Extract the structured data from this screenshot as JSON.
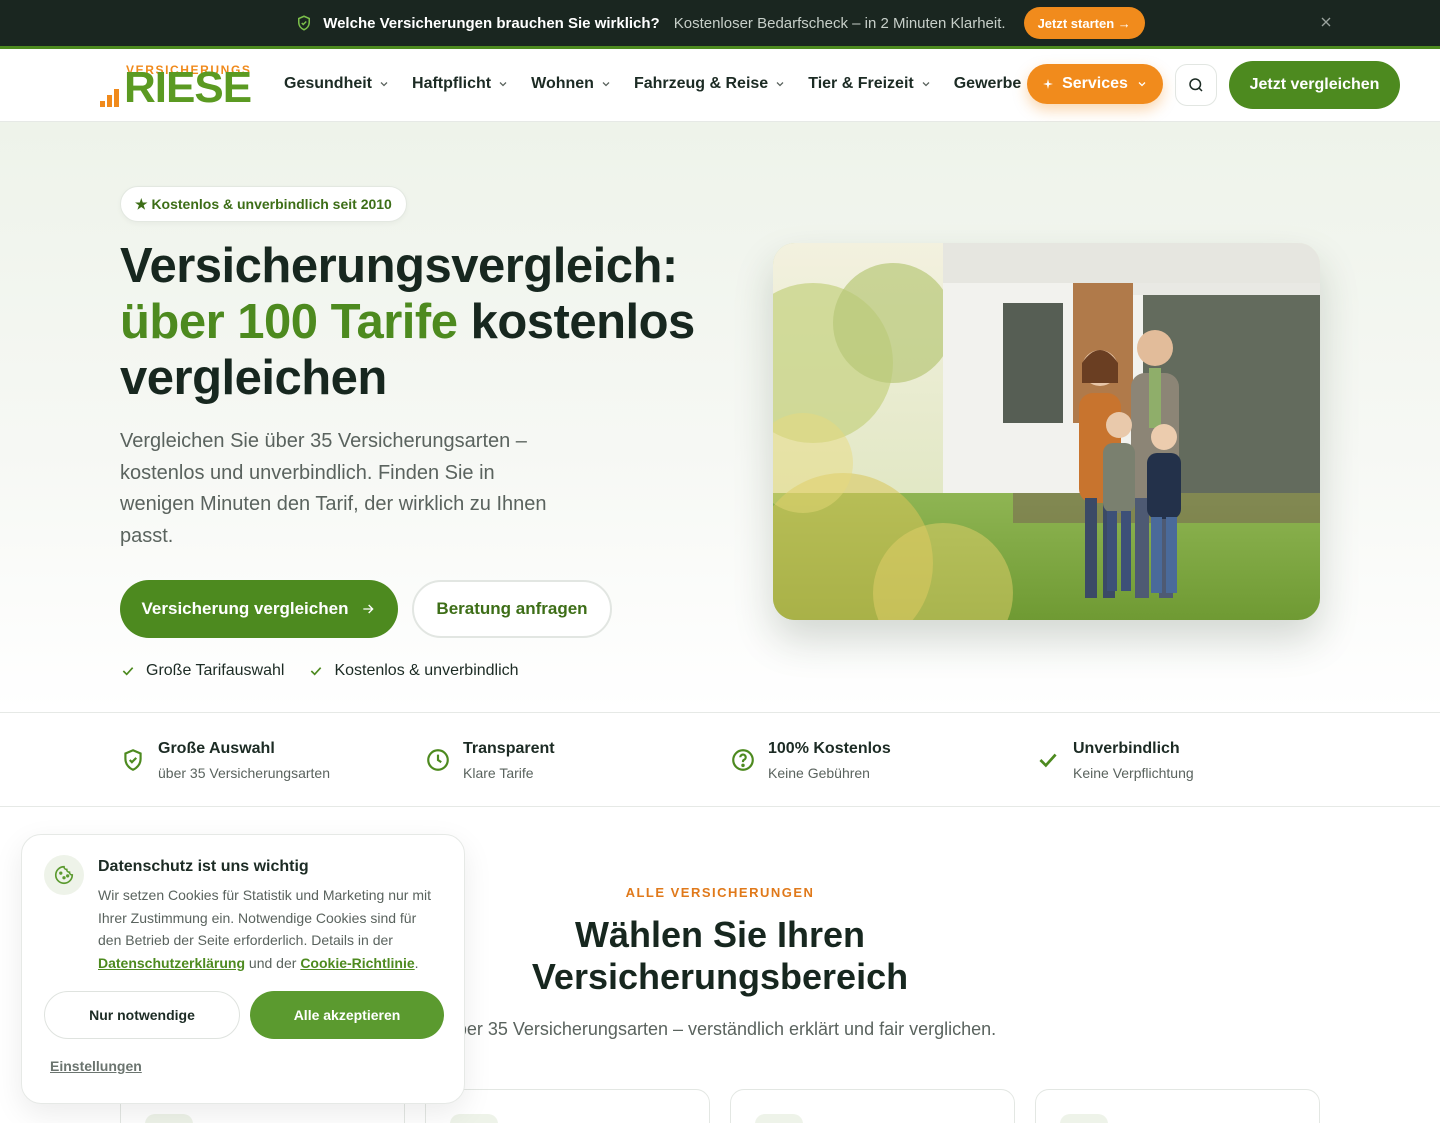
{
  "announcement": {
    "bold": "Welche Versicherungen brauchen Sie wirklich?",
    "text": "Kostenloser Bedarfscheck – in 2 Minuten Klarheit.",
    "cta": "Jetzt starten →"
  },
  "header": {
    "logo_top": "VERSICHERUNGS",
    "logo_main": "RIESE",
    "nav": [
      "Gesundheit",
      "Haftpflicht",
      "Wohnen",
      "Fahrzeug & Reise",
      "Tier & Freizeit",
      "Gewerbe"
    ],
    "services": "Services",
    "compare": "Jetzt vergleichen"
  },
  "hero": {
    "badge": "★ Kostenlos & unverbindlich seit 2010",
    "title_line1": "Versicherungsvergleich:",
    "title_green": "über 100 Tarife",
    "title_rest": " kostenlos vergleichen",
    "subtitle": "Vergleichen Sie über 35 Versicherungsarten – kostenlos und unverbindlich. Finden Sie in wenigen Minuten den Tarif, der wirklich zu Ihnen passt.",
    "btn_primary": "Versicherung vergleichen",
    "btn_secondary": "Beratung anfragen",
    "checks": [
      "Große Tarifauswahl",
      "Kostenlos & unverbindlich"
    ]
  },
  "features": [
    {
      "title": "Große Auswahl",
      "sub": "über 35 Versicherungsarten",
      "icon": "shield-check-icon"
    },
    {
      "title": "Transparent",
      "sub": "Klare Tarife",
      "icon": "clock-icon"
    },
    {
      "title": "100% Kostenlos",
      "sub": "Keine Gebühren",
      "icon": "help-circle-icon"
    },
    {
      "title": "Unverbindlich",
      "sub": "Keine Verpflichtung",
      "icon": "check-icon"
    }
  ],
  "section": {
    "eyebrow": "ALLE VERSICHERUNGEN",
    "title": "Wählen Sie Ihren Versicherungsbereich",
    "subtitle": "Über 35 Versicherungsarten – verständlich erklärt und fair verglichen."
  },
  "cookie": {
    "title": "Datenschutz ist uns wichtig",
    "text_before": "Wir setzen Cookies für Statistik und Marketing nur mit Ihrer Zustimmung ein. Notwendige Cookies sind für den Betrieb der Seite erforderlich. Details in der ",
    "link1": "Datenschutzerklärung",
    "text_mid": " und der ",
    "link2": "Cookie-Richtlinie",
    "text_end": ".",
    "btn_necessary": "Nur notwendige",
    "btn_accept": "Alle akzeptieren",
    "settings": "Einstellungen"
  },
  "colors": {
    "brand_green": "#4d8a1f",
    "brand_orange": "#f18b1c",
    "dark": "#1a2620"
  }
}
